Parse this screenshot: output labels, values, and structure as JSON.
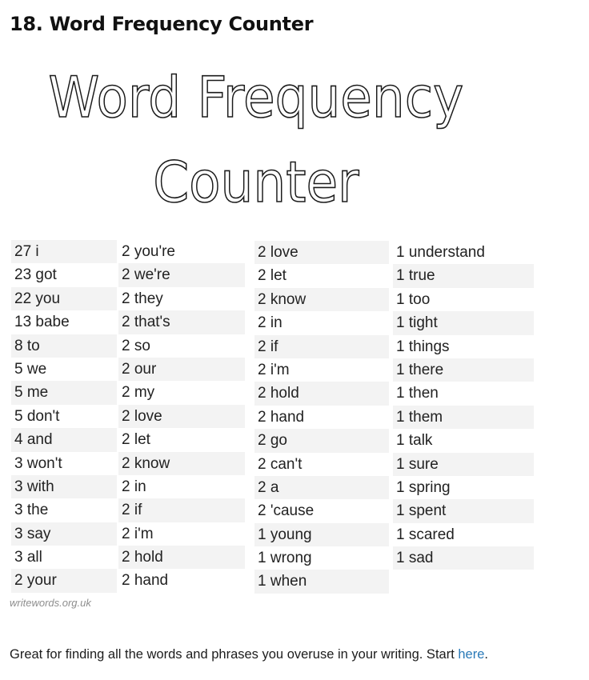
{
  "heading": "18. Word Frequency Counter",
  "graphic": {
    "title_line1": "Word Frequency",
    "title_line2": "Counter",
    "credit": "writewords.org.uk",
    "columns": [
      [
        "27 i",
        "23 got",
        "22 you",
        "13 babe",
        "8 to",
        "5 we",
        "5 me",
        "5 don't",
        "4 and",
        "3 won't",
        "3 with",
        "3 the",
        "3 say",
        "3 all",
        "2 your"
      ],
      [
        "2 you're",
        "2 we're",
        "2 they",
        "2 that's",
        "2 so",
        "2 our",
        "2 my",
        "2 love",
        "2 let",
        "2 know",
        "2 in",
        "2 if",
        "2 i'm",
        "2 hold",
        "2 hand"
      ],
      [
        "2 love",
        "2 let",
        "2 know",
        "2 in",
        "2 if",
        "2 i'm",
        "2 hold",
        "2 hand",
        "2 go",
        "2 can't",
        "2 a",
        "2 'cause",
        "1 young",
        "1 wrong",
        "1 when"
      ],
      [
        "1 understand",
        "1 true",
        "1 too",
        "1 tight",
        "1 things",
        "1 there",
        "1 then",
        "1 them",
        "1 talk",
        "1 sure",
        "1 spring",
        "1 spent",
        "1 scared",
        "1 sad",
        ""
      ]
    ]
  },
  "caption": {
    "text": "Great for finding all the words and phrases you overuse in your writing. Start ",
    "link_label": "here",
    "trailing": ".",
    "link_color": "#2a7ab8"
  }
}
